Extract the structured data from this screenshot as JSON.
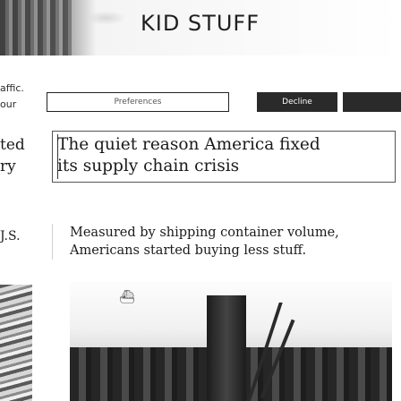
{
  "header": {
    "logo_text": "KID STUFF"
  },
  "cookie_bar": {
    "text_line1": "affic.",
    "text_line2": "our",
    "preferences_label": "Preferences",
    "decline_label": "Decline",
    "accept_label": ""
  },
  "story": {
    "side_text": [
      "ted",
      "ry",
      "J.S."
    ],
    "headline_lines": [
      "The quiet reason America fixed",
      "its supply chain crisis"
    ],
    "summary": "Measured by shipping container volume, Americans started buying less stuff."
  },
  "hero_image": {
    "icon": "ship-icon"
  }
}
